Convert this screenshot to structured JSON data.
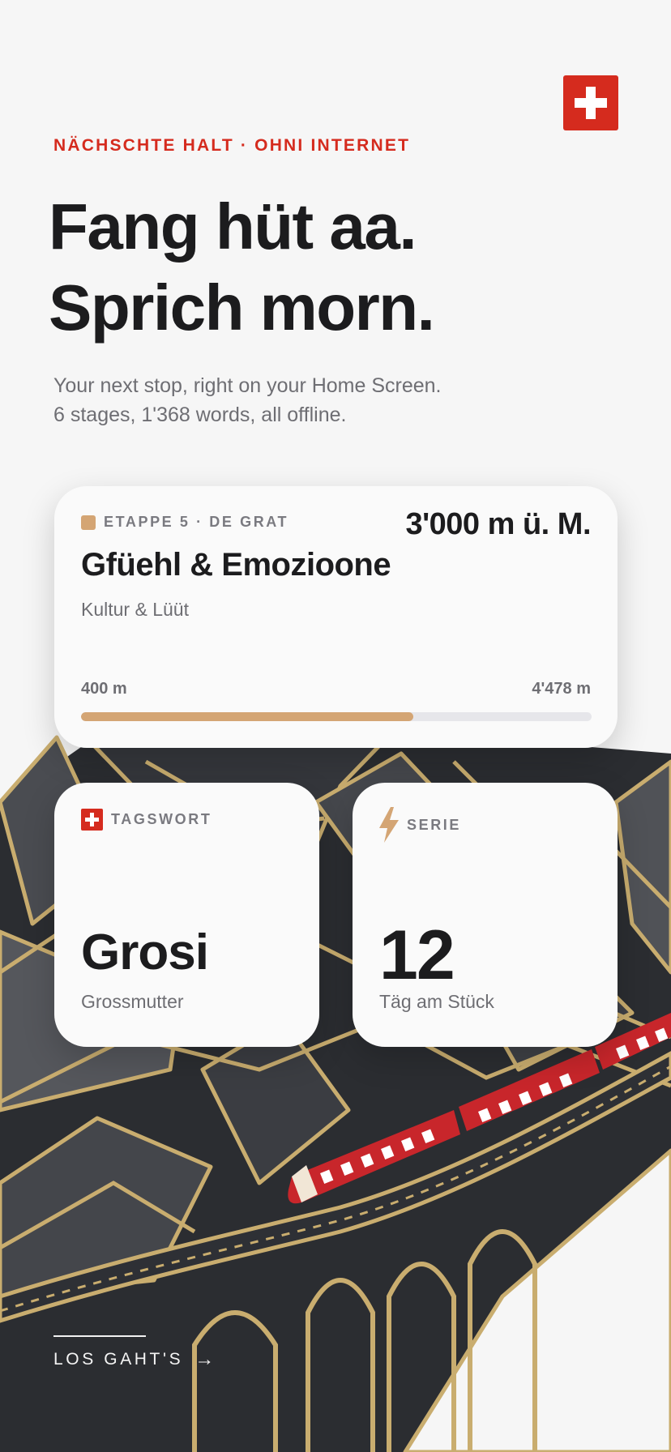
{
  "eyebrow": "NÄCHSCHTE HALT · OHNI INTERNET",
  "headline": {
    "line1": "Fang hüt aa.",
    "line2": "Sprich morn."
  },
  "subtitle": {
    "line1": "Your next stop, right on your Home Screen.",
    "line2": "6 stages, 1'368 words, all offline."
  },
  "stage_card": {
    "label": "ETAPPE 5 · DE GRAT",
    "altitude": "3'000 m ü. M.",
    "title": "Gfüehl & Emozioone",
    "subtitle": "Kultur & Lüüt",
    "range_min": "400 m",
    "range_max": "4'478 m",
    "progress": 0.65,
    "accent": "#d4a574"
  },
  "word_card": {
    "label": "TAGSWORT",
    "word": "Grosi",
    "meaning": "Grossmutter",
    "icon": "swiss-flag-icon"
  },
  "streak_card": {
    "label": "SERIE",
    "value": "12",
    "caption": "Täg am Stück",
    "icon": "lightning-bolt-icon",
    "icon_color": "#d4a574"
  },
  "cta": {
    "label": "LOS GAHT'S",
    "arrow": "→"
  },
  "colors": {
    "brand_red": "#d52b1e",
    "accent_gold": "#d4a574",
    "mountain_dark": "#2b2d31",
    "outline_gold": "#c9ad6f"
  },
  "top_icon": "swiss-flag-icon"
}
